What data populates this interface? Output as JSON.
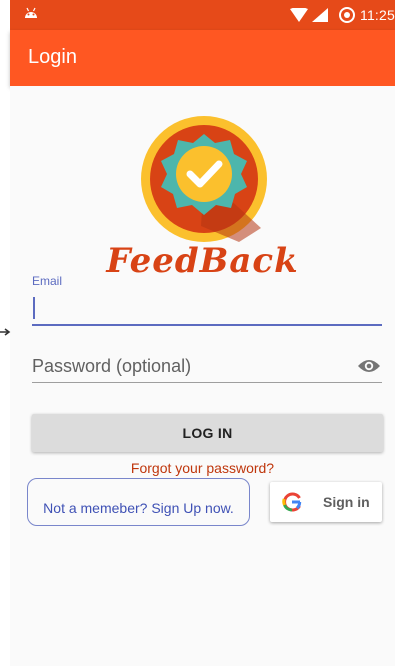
{
  "status_bar": {
    "time": "11:25"
  },
  "app_bar": {
    "title": "Login"
  },
  "brand": {
    "name": "FeedBack"
  },
  "form": {
    "email_label": "Email",
    "email_value": "",
    "password_placeholder": "Password (optional)",
    "login_label": "LOG IN",
    "forgot_label": "Forgot your password?",
    "signup_label": "Not a memeber? Sign Up now.",
    "google_label": "Sign in"
  },
  "icons": {
    "status": [
      "android-icon",
      "wifi-icon",
      "signal-icon",
      "alarm-icon"
    ],
    "password": "eye-icon",
    "google": "google-g-icon",
    "logo": "checkmark-badge-icon"
  },
  "colors": {
    "status_bar": "#e64a19",
    "app_bar": "#ff5722",
    "accent": "#5c6bc0",
    "brand": "#d84315",
    "link": "#bf360c"
  }
}
